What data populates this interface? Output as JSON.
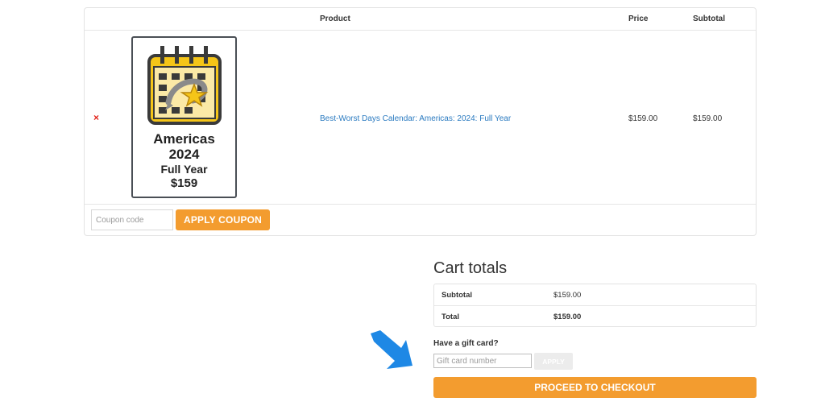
{
  "cart": {
    "headers": {
      "product": "Product",
      "price": "Price",
      "subtotal": "Subtotal"
    },
    "item": {
      "remove_symbol": "×",
      "thumb_lines": [
        "Americas",
        "2024",
        "Full Year",
        "$159"
      ],
      "product_name": "Best-Worst Days Calendar: Americas: 2024: Full Year",
      "price": "$159.00",
      "subtotal": "$159.00"
    },
    "coupon": {
      "placeholder": "Coupon code",
      "button_label": "APPLY COUPON"
    }
  },
  "totals": {
    "title": "Cart totals",
    "rows": [
      {
        "label": "Subtotal",
        "value": "$159.00"
      },
      {
        "label": "Total",
        "value": "$159.00"
      }
    ]
  },
  "gift_card": {
    "question": "Have a gift card?",
    "placeholder": "Gift card number",
    "button_label": "APPLY"
  },
  "checkout": {
    "button_label": "PROCEED TO CHECKOUT"
  },
  "colors": {
    "accent": "#f39c2f",
    "link": "#2a7ac0",
    "remove": "#e2231a",
    "arrow": "#1e88e5"
  },
  "icons": {
    "product_thumbnail": "calendar-icon",
    "annotation": "arrow-icon"
  }
}
